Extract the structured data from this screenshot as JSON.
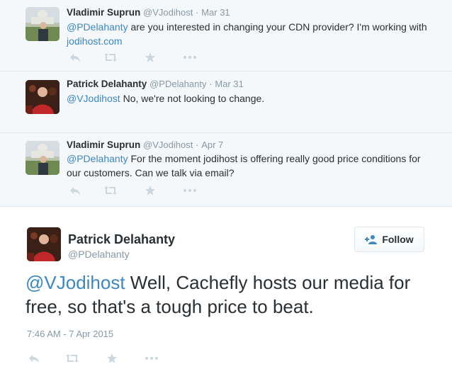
{
  "conversation": [
    {
      "name": "Vladimir Suprun",
      "handle": "@VJodihost",
      "separator": "·",
      "date": "Mar 31",
      "mention": "@PDelahanty",
      "text_before": " are you interested in changing your CDN provider? I'm working with ",
      "link": "jodihost.com",
      "text_after": ""
    },
    {
      "name": "Patrick Delahanty",
      "handle": "@PDelahanty",
      "separator": "·",
      "date": "Mar 31",
      "mention": "@VJodihost",
      "text_before": " No, we're not looking to change.",
      "link": "",
      "text_after": ""
    },
    {
      "name": "Vladimir Suprun",
      "handle": "@VJodihost",
      "separator": "·",
      "date": "Apr 7",
      "mention": "@PDelahanty",
      "text_before": " For the moment jodihost is offering really good price conditions for our customers. Can we talk via email?",
      "link": "",
      "text_after": ""
    }
  ],
  "main_tweet": {
    "name": "Patrick Delahanty",
    "handle": "@PDelahanty",
    "follow_label": "Follow",
    "mention": "@VJodihost",
    "text": " Well, Cachefly hosts our media for free, so that's a tough price to beat.",
    "timestamp": "7:46 AM - 7 Apr 2015"
  },
  "icons": [
    "reply-icon",
    "retweet-icon",
    "favorite-icon",
    "more-icon",
    "follow-person-icon"
  ],
  "colors": {
    "link": "#3b88c3",
    "muted": "#8899a6",
    "conversation_bg": "#f5f8fa",
    "icon": "#ccd6dd"
  }
}
